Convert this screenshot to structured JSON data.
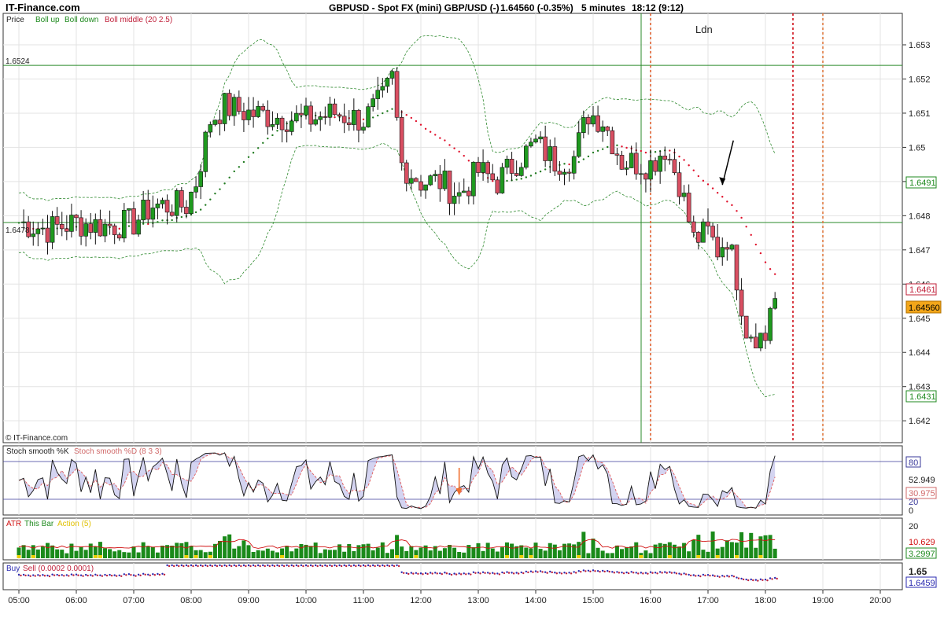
{
  "header": {
    "brand": "IT-Finance.com",
    "instrument": "GBPUSD - Spot FX (mini) GBP/USD (-)",
    "quote": "1.64560 (-0.35%)",
    "interval": "5 minutes",
    "time": "18:12 (9:12)"
  },
  "price_panel": {
    "legend_price": "Price",
    "legend_up": "Boll up",
    "legend_down": "Boll down",
    "legend_middle": "Boll middle (20 2.5)",
    "session_label": "Ldn",
    "hline_high_label": "1.6524",
    "hline_low_label": "1.6478",
    "watermark": "© IT-Finance.com",
    "marker_upper_band": "1.6491",
    "marker_middle_band": "1.6461",
    "marker_last": "1.64560",
    "marker_lower_band": "1.6431",
    "colors": {
      "up": "#1f9a1f",
      "down": "#d94f62",
      "band": "#2f8a2f",
      "middle_up": "#1f7a1f",
      "middle_down": "#e0102a"
    }
  },
  "stoch_panel": {
    "legend_k": "Stoch smooth %K",
    "legend_d": "Stoch smooth %D (8 3 3)",
    "marker_80": "80",
    "marker_k": "52.949",
    "marker_d": "30.975",
    "marker_20": "20",
    "marker_0": "0"
  },
  "atr_panel": {
    "legend_atr": "ATR",
    "legend_thisbar": "This Bar",
    "legend_action": "Action (5)",
    "marker_20": "20",
    "marker_atr": "10.629",
    "marker_action": "3.2997"
  },
  "buysell_panel": {
    "legend_buy": "Buy",
    "legend_sell": "Sell (0.0002 0.0001)",
    "marker_top": "1.65",
    "marker_value": "1.6459"
  },
  "time_axis": [
    "05:00",
    "06:00",
    "07:00",
    "08:00",
    "09:00",
    "10:00",
    "11:00",
    "12:00",
    "13:00",
    "14:00",
    "15:00",
    "16:00",
    "17:00",
    "18:00",
    "19:00",
    "20:00"
  ],
  "chart_data": {
    "type": "candlestick",
    "title": "GBPUSD - Spot FX (mini) GBP/USD (-)",
    "interval": "5 minutes",
    "y_ticks": [
      "1.653",
      "1.652",
      "1.651",
      "1.65",
      "1.649",
      "1.648",
      "1.647",
      "1.646",
      "1.645",
      "1.644",
      "1.643",
      "1.642"
    ],
    "ylim": [
      1.6415,
      1.6538
    ],
    "hlines": [
      1.6524,
      1.6478
    ],
    "session_start": "16:00",
    "anchors": [
      [
        "05:00",
        1.6478
      ],
      [
        "05:30",
        1.6476
      ],
      [
        "06:00",
        1.6478
      ],
      [
        "06:30",
        1.6477
      ],
      [
        "07:00",
        1.6478
      ],
      [
        "07:20",
        1.6483
      ],
      [
        "07:55",
        1.6483
      ],
      [
        "08:05",
        1.649
      ],
      [
        "08:20",
        1.6508
      ],
      [
        "08:35",
        1.6512
      ],
      [
        "09:00",
        1.651
      ],
      [
        "09:30",
        1.6509
      ],
      [
        "10:00",
        1.6508
      ],
      [
        "10:30",
        1.651
      ],
      [
        "11:00",
        1.6508
      ],
      [
        "11:20",
        1.6514
      ],
      [
        "11:30",
        1.652
      ],
      [
        "11:40",
        1.6495
      ],
      [
        "12:00",
        1.649
      ],
      [
        "12:20",
        1.649
      ],
      [
        "12:40",
        1.6486
      ],
      [
        "13:00",
        1.6493
      ],
      [
        "13:20",
        1.649
      ],
      [
        "13:40",
        1.6496
      ],
      [
        "14:00",
        1.6501
      ],
      [
        "14:20",
        1.6496
      ],
      [
        "14:40",
        1.6497
      ],
      [
        "14:55",
        1.651
      ],
      [
        "15:10",
        1.6508
      ],
      [
        "15:30",
        1.6496
      ],
      [
        "16:00",
        1.6495
      ],
      [
        "16:15",
        1.65
      ],
      [
        "16:30",
        1.649
      ],
      [
        "16:45",
        1.6473
      ],
      [
        "17:00",
        1.6475
      ],
      [
        "17:10",
        1.647
      ],
      [
        "17:20",
        1.6474
      ],
      [
        "17:30",
        1.6462
      ],
      [
        "17:40",
        1.6447
      ],
      [
        "18:00",
        1.6444
      ],
      [
        "18:05",
        1.6454
      ],
      [
        "18:12",
        1.6456
      ]
    ],
    "stoch_range": [
      0,
      100
    ],
    "atr_range": [
      0,
      20
    ],
    "annotations": [
      "arrow at 17:15",
      "arrow at 12:40 (stoch)"
    ]
  }
}
